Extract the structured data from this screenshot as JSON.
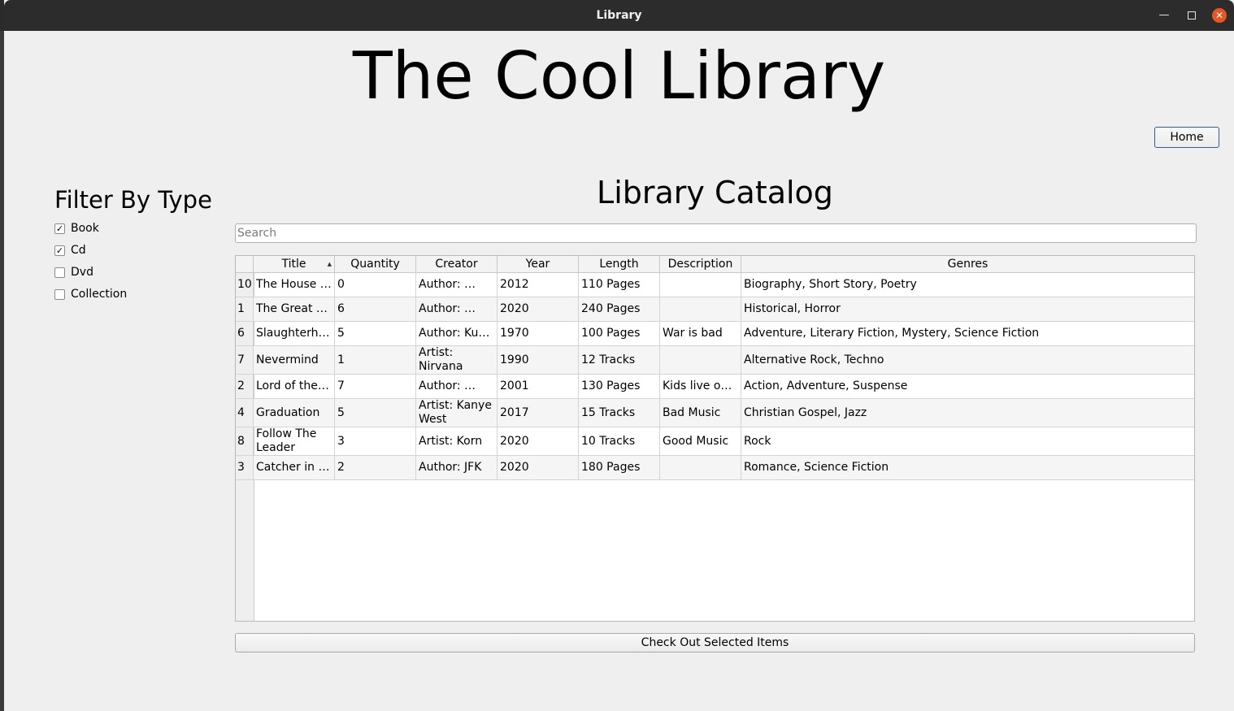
{
  "window": {
    "title": "Library",
    "minimize_icon": "minimize-icon",
    "maximize_icon": "maximize-icon",
    "close_icon": "close-icon",
    "close_glyph": "✕",
    "minimize_glyph": "—"
  },
  "header": {
    "app_title": "The Cool Library",
    "home_label": "Home"
  },
  "filter": {
    "title": "Filter By Type",
    "items": [
      {
        "label": "Book",
        "checked": true
      },
      {
        "label": "Cd",
        "checked": true
      },
      {
        "label": "Dvd",
        "checked": false
      },
      {
        "label": "Collection",
        "checked": false
      }
    ]
  },
  "catalog": {
    "title": "Library Catalog",
    "search_placeholder": "Search",
    "sort_column": "Title",
    "sort_direction": "ascending",
    "columns": [
      "Title",
      "Quantity",
      "Creator",
      "Year",
      "Length",
      "Description",
      "Genres"
    ],
    "rows": [
      {
        "id": "10",
        "title": "The House …",
        "quantity": "0",
        "creator": "Author: …",
        "year": "2012",
        "length": "110 Pages",
        "description": "",
        "genres": "Biography, Short Story, Poetry"
      },
      {
        "id": "1",
        "title": "The Great …",
        "quantity": "6",
        "creator": "Author: …",
        "year": "2020",
        "length": "240 Pages",
        "description": "",
        "genres": "Historical, Horror"
      },
      {
        "id": "6",
        "title": "Slaughterh…",
        "quantity": "5",
        "creator": "Author: Ku…",
        "year": "1970",
        "length": "100 Pages",
        "description": "War is bad",
        "genres": "Adventure, Literary Fiction, Mystery, Science Fiction"
      },
      {
        "id": "7",
        "title": "Nevermind",
        "quantity": "1",
        "creator": "Artist: Nirvana",
        "year": "1990",
        "length": "12 Tracks",
        "description": "",
        "genres": "Alternative Rock, Techno"
      },
      {
        "id": "2",
        "title": "Lord of the…",
        "quantity": "7",
        "creator": "Author: …",
        "year": "2001",
        "length": "130 Pages",
        "description": "Kids live on…",
        "genres": "Action, Adventure, Suspense"
      },
      {
        "id": "4",
        "title": "Graduation",
        "quantity": "5",
        "creator": "Artist: Kanye West",
        "year": "2017",
        "length": "15 Tracks",
        "description": "Bad Music",
        "genres": "Christian Gospel, Jazz"
      },
      {
        "id": "8",
        "title": "Follow The Leader",
        "quantity": "3",
        "creator": "Artist: Korn",
        "year": "2020",
        "length": "10 Tracks",
        "description": "Good Music",
        "genres": "Rock"
      },
      {
        "id": "3",
        "title": "Catcher in …",
        "quantity": "2",
        "creator": "Author: JFK",
        "year": "2020",
        "length": "180 Pages",
        "description": "",
        "genres": "Romance, Science Fiction"
      }
    ],
    "checkout_label": "Check Out Selected Items"
  },
  "colors": {
    "accent": "#e95420",
    "titlebar": "#2c2c2c",
    "window_bg": "#efefef"
  }
}
